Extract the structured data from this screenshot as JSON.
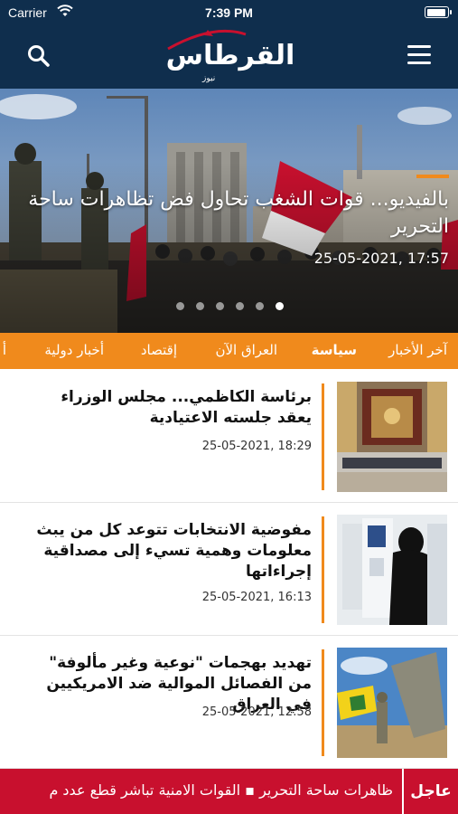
{
  "status_bar": {
    "carrier": "Carrier",
    "time": "7:39 PM"
  },
  "header": {
    "logo_text": "القرطاس",
    "logo_sub": "نيوز",
    "logo_color": "#c8102e",
    "search_icon": "search-icon",
    "menu_icon": "hamburger-menu-icon"
  },
  "hero": {
    "title": "بالفيديو... قوات الشغب تحاول فض تظاهرات ساحة التحرير",
    "date": "25-05-2021, 17:57",
    "slide_count": 6,
    "active_slide": 6
  },
  "categories": [
    {
      "label": "آخر الأخبار",
      "active": false
    },
    {
      "label": "سياسة",
      "active": true
    },
    {
      "label": "العراق الآن",
      "active": false
    },
    {
      "label": "إقتصاد",
      "active": false
    },
    {
      "label": "أخبار دولية",
      "active": false
    },
    {
      "label": "أ",
      "active": false
    }
  ],
  "news": [
    {
      "title": "برئاسة الكاظمي... مجلس الوزراء يعقد جلسته الاعتيادية",
      "date": "25-05-2021, 18:29"
    },
    {
      "title": "مفوضية الانتخابات تتوعد كل من يبث معلومات وهمية تسيء إلى مصداقية إجراءاتها",
      "date": "25-05-2021, 16:13"
    },
    {
      "title": "تهديد بهجمات \"نوعية وغير مألوفة\" من الفصائل الموالية ضد الامريكيين في العراق",
      "date": "25-05-2021, 12:58"
    }
  ],
  "ticker": {
    "label": "عاجل",
    "text": "ظاهرات ساحة التحرير ▪ القوات الامنية تباشر قطع عدد م"
  },
  "colors": {
    "header": "#0f2e4d",
    "accent": "#f08a1c",
    "ticker": "#c8102e"
  }
}
